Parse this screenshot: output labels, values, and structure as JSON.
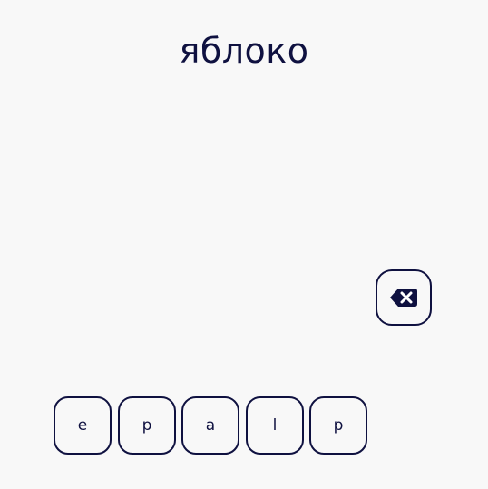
{
  "prompt": {
    "word": "яблоко"
  },
  "controls": {
    "backspace_icon": "backspace-icon"
  },
  "letters": [
    {
      "char": "e"
    },
    {
      "char": "p"
    },
    {
      "char": "a"
    },
    {
      "char": "l"
    },
    {
      "char": "p"
    }
  ],
  "colors": {
    "background": "#f8f8f8",
    "ink": "#0f1140"
  }
}
